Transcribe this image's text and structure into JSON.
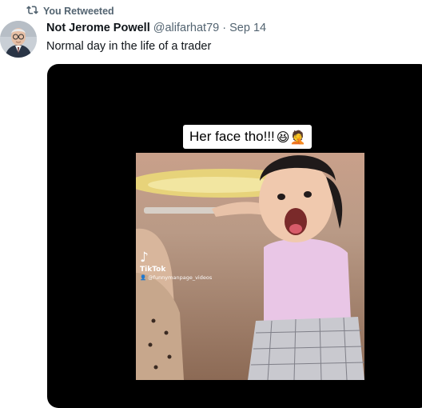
{
  "retweet": {
    "label": "You Retweeted",
    "icon": "retweet-icon"
  },
  "tweet": {
    "author_name": "Not Jerome Powell",
    "handle": "@alifarhat79",
    "separator": "·",
    "date": "Sep 14",
    "text": "Normal day in the life of a trader"
  },
  "media": {
    "caption": "Her face tho!!!",
    "caption_emojis": "😆🤦",
    "watermark": {
      "icon": "tiktok-note-icon",
      "note_glyph": "♪",
      "brand": "TikTok",
      "username": "👤 @funnymanpage_videos"
    }
  },
  "colors": {
    "text_primary": "#0f1419",
    "text_secondary": "#536471",
    "media_background": "#000000"
  }
}
